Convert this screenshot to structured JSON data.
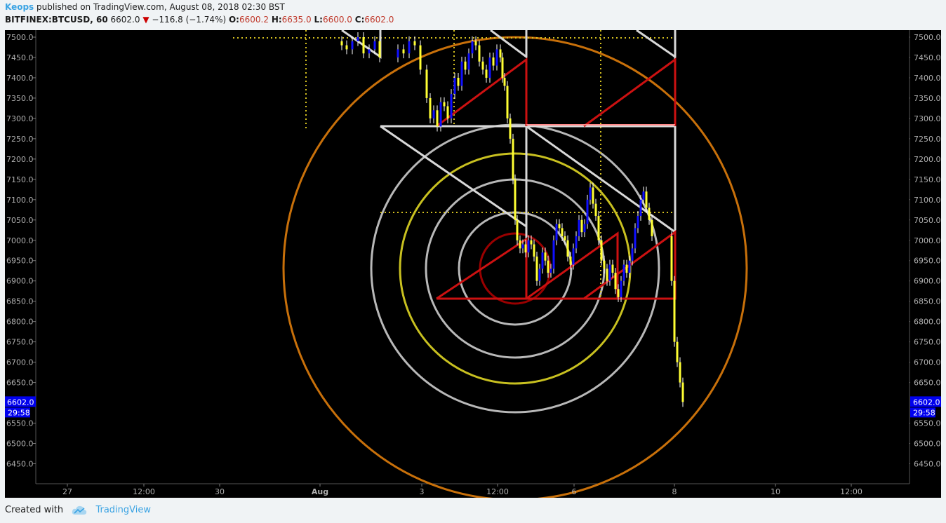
{
  "header": {
    "author": "Keops",
    "published_text": "published on TradingView.com, August 08, 2018 02:30 BST",
    "symbol": "BITFINEX:BTCUSD, 60",
    "last": "6602.0",
    "change": "−116.8 (−1.74%)",
    "o_label": "O:",
    "o_value": "6600.2",
    "h_label": "H:",
    "h_value": "6635.0",
    "l_label": "L:",
    "l_value": "6600.0",
    "c_label": "C:",
    "c_value": "6602.0"
  },
  "footer": {
    "created_with": "Created with",
    "brand": "TradingView"
  },
  "colors": {
    "background": "#000000",
    "up_candle": "#1010ff",
    "down_candle": "#ffff33",
    "wick": "#ffffff",
    "triangles": "#cc1111",
    "white_lines": "#d8d8d8",
    "dotted": "#d4c020",
    "outer_circle": "#c8700a",
    "yellow_circle": "#c8c020",
    "gray_circles": "#b8b8b8",
    "inner_red_circle": "#990000",
    "price_tag": "#0000ee"
  },
  "chart_data": {
    "type": "candlestick",
    "title": "BITFINEX:BTCUSD, 60",
    "y_axis": {
      "ticks": [
        "7500.0",
        "7450.0",
        "7400.0",
        "7350.0",
        "7300.0",
        "7250.0",
        "7200.0",
        "7150.0",
        "7100.0",
        "7050.0",
        "7000.0",
        "6950.0",
        "6900.0",
        "6850.0",
        "6800.0",
        "6750.0",
        "6700.0",
        "6650.0",
        "6550.0",
        "6500.0",
        "6450.0"
      ],
      "range": [
        6410,
        7510
      ]
    },
    "x_axis": {
      "ticks": [
        "27",
        "12:00",
        "30",
        "Aug",
        "3",
        "12:00",
        "6",
        "8",
        "10",
        "12:00"
      ]
    },
    "last_price_label": "6602.0",
    "countdown_label": "29:58",
    "series": [
      {
        "close": [
          7480,
          7470,
          7490,
          7500,
          7460,
          7470,
          7490,
          7450,
          7470,
          7460,
          7490,
          7480,
          7420,
          7350,
          7300,
          7320,
          7280,
          7340,
          7330,
          7300,
          7360,
          7400,
          7380,
          7440,
          7420,
          7460,
          7490,
          7480,
          7440,
          7420,
          7400,
          7450,
          7430,
          7470,
          7450,
          7400,
          7380,
          7300,
          7250,
          7150,
          7050,
          7000,
          6980,
          6990,
          6970,
          7000,
          6990,
          6960,
          6900,
          6930,
          6970,
          6950,
          6920,
          6930,
          7000,
          7040,
          7030,
          7010,
          7000,
          6960,
          6940,
          6980,
          7010,
          7050,
          7020,
          7040,
          7100,
          7130,
          7090,
          7060,
          7000,
          6950,
          6930,
          6900,
          6940,
          6920,
          6880,
          6860,
          6900,
          6940,
          6920,
          6950,
          6980,
          7030,
          7060,
          7100,
          7120,
          7080,
          7050,
          7010,
          6900,
          6750,
          6700,
          6650,
          6602
        ]
      }
    ]
  }
}
